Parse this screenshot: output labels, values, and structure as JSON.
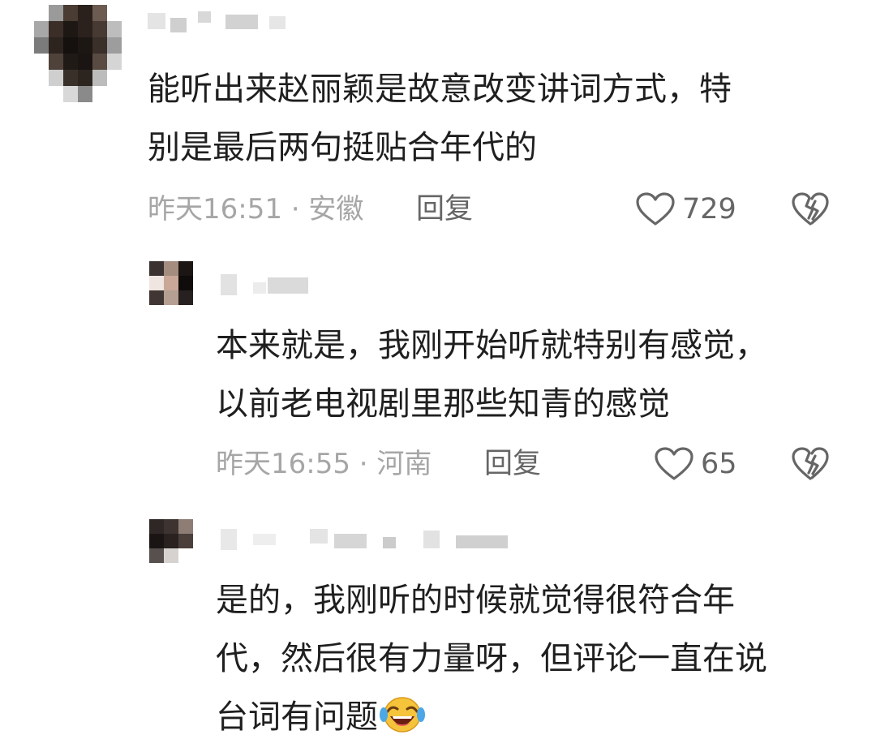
{
  "comments": [
    {
      "text_lines": [
        "能听出来赵丽颖是故意改变讲词方式，特",
        "别是最后两句挺贴合年代的"
      ],
      "time": "昨天16:51",
      "location": "安徽",
      "reply_label": "回复",
      "likes": "729"
    },
    {
      "text_lines": [
        "本来就是，我刚开始听就特别有感觉，",
        "以前老电视剧里那些知青的感觉"
      ],
      "time": "昨天16:55",
      "location": "河南",
      "reply_label": "回复",
      "likes": "65"
    },
    {
      "text_lines": [
        "是的，我刚听的时候就觉得很符合年",
        "代，然后很有力量呀，但评论一直在说",
        "台词有问题"
      ]
    }
  ],
  "meta_separator": " · ",
  "icons": {
    "like": "heart-outline-icon",
    "dislike": "broken-heart-icon",
    "emoji": "laughing-crying-emoji-icon"
  },
  "colors": {
    "meta_gray": "#a6a6a6",
    "action_gray": "#666666",
    "text": "#1f1f1f"
  }
}
